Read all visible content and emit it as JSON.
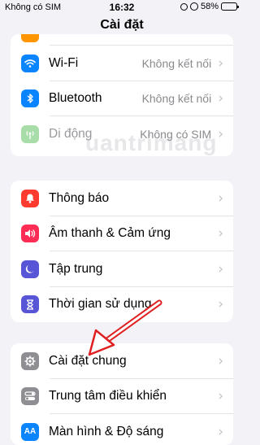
{
  "status_bar": {
    "carrier": "Không có SIM",
    "time": "16:32",
    "battery": "58%",
    "battery_level": 0.58
  },
  "header": {
    "title": "Cài đặt"
  },
  "groups": {
    "connectivity": [
      {
        "label": "Wi-Fi",
        "value": "Không kết nối",
        "icon": "wifi-icon",
        "color": "#0a84ff"
      },
      {
        "label": "Bluetooth",
        "value": "Không kết nối",
        "icon": "bluetooth-icon",
        "color": "#0a84ff"
      },
      {
        "label": "Di động",
        "value": "Không có SIM",
        "icon": "cellular-icon",
        "color": "#a8dca8"
      }
    ],
    "notifications": [
      {
        "label": "Thông báo",
        "icon": "bell-icon",
        "color": "#ff3b30"
      },
      {
        "label": "Âm thanh & Cảm ứng",
        "icon": "speaker-icon",
        "color": "#ff2d55"
      },
      {
        "label": "Tập trung",
        "icon": "moon-icon",
        "color": "#5856d6"
      },
      {
        "label": "Thời gian sử dụng",
        "icon": "hourglass-icon",
        "color": "#5856d6"
      }
    ],
    "general": [
      {
        "label": "Cài đặt chung",
        "icon": "gear-icon",
        "color": "#8e8e93"
      },
      {
        "label": "Trung tâm điều khiển",
        "icon": "toggles-icon",
        "color": "#8e8e93"
      },
      {
        "label": "Màn hình & Độ sáng",
        "icon": "display-icon",
        "color": "#0a84ff"
      }
    ]
  },
  "watermark": "uantrimang",
  "chevron": "›"
}
